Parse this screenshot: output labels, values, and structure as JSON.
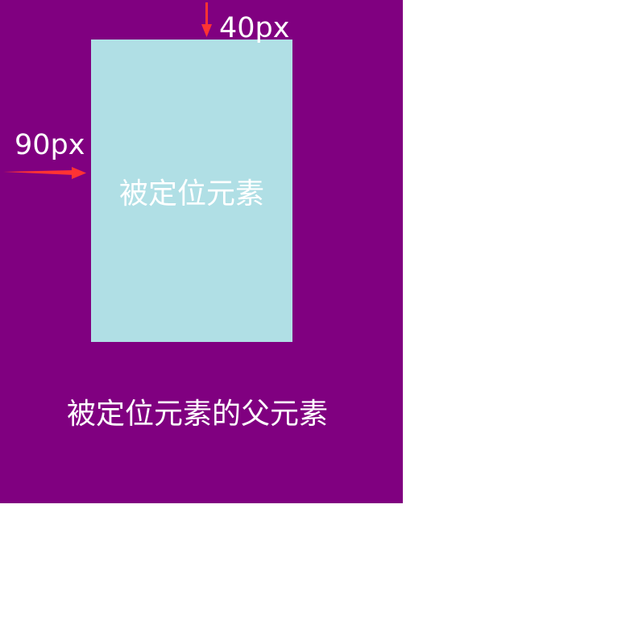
{
  "colors": {
    "parent_background": "#800080",
    "child_background": "#b0dfe5",
    "text": "#ffffff",
    "arrow": "#ff3333"
  },
  "labels": {
    "child": "被定位元素",
    "parent": "被定位元素的父元素",
    "top_offset": "40px",
    "left_offset": "90px"
  },
  "icons": {
    "top_arrow": "down-arrow-icon",
    "left_arrow": "right-arrow-icon"
  }
}
